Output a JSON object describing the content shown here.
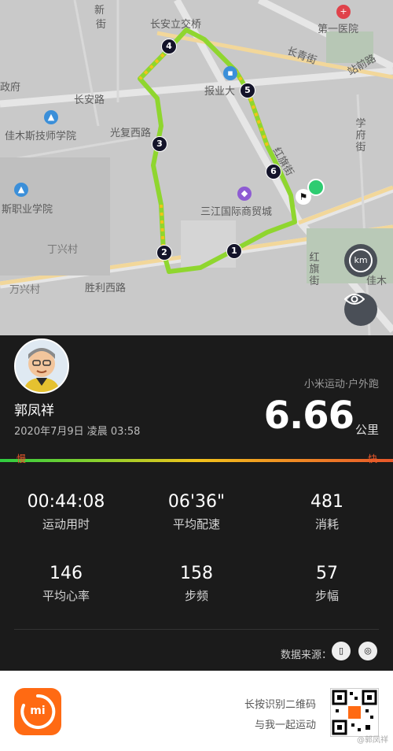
{
  "map": {
    "labels": {
      "xinhua_st_fragment": "街",
      "xinhua_top": "新",
      "changan_bridge": "长安立交桥",
      "first_hospital": "第一医院",
      "changqing_st": "长青街",
      "zhanqian_rd": "站前路",
      "zhengfu_fragment": "政府",
      "baoye": "报业大",
      "changan_rd": "长安路",
      "jiamusi_tech": "佳木斯技师学院",
      "guangfu_west": "光复西路",
      "xuefu_st": "学府街",
      "hongqi_partial": "红旗街",
      "career_school": "斯职业学院",
      "sanjiang_plaza": "三江国际商贸城",
      "dingxing_village": "丁兴村",
      "wanxing_village": "万兴村",
      "shengli_west": "胜利西路",
      "hongqi_st": "红旗街",
      "jiamu_fragment": "佳木"
    },
    "route_markers": [
      "1",
      "2",
      "3",
      "4",
      "5",
      "6"
    ],
    "buttons": {
      "km": "km",
      "eye": "view"
    }
  },
  "profile": {
    "name": "郭凤祥",
    "datetime": "2020年7月9日 凌晨 03:58",
    "source": "小米运动·户外跑"
  },
  "summary": {
    "distance": "6.66",
    "distance_unit": "公里"
  },
  "pace_bar": {
    "slow": "慢",
    "fast": "快"
  },
  "stats": [
    {
      "value": "00:44:08",
      "label": "运动用时"
    },
    {
      "value": "06'36\"",
      "label": "平均配速"
    },
    {
      "value": "481",
      "label": "消耗"
    },
    {
      "value": "146",
      "label": "平均心率"
    },
    {
      "value": "158",
      "label": "步频"
    },
    {
      "value": "57",
      "label": "步幅"
    }
  ],
  "data_source": {
    "label": "数据来源："
  },
  "footer": {
    "qr_line1": "长按识别二维码",
    "qr_line2": "与我一起运动",
    "logo_text": "mi",
    "watermark": "@郭凤祥"
  },
  "colors": {
    "brand_orange": "#ff6a13",
    "route_green": "#7bd436",
    "route_yellow": "#f2c31b",
    "finish_green": "#2ecc71"
  }
}
